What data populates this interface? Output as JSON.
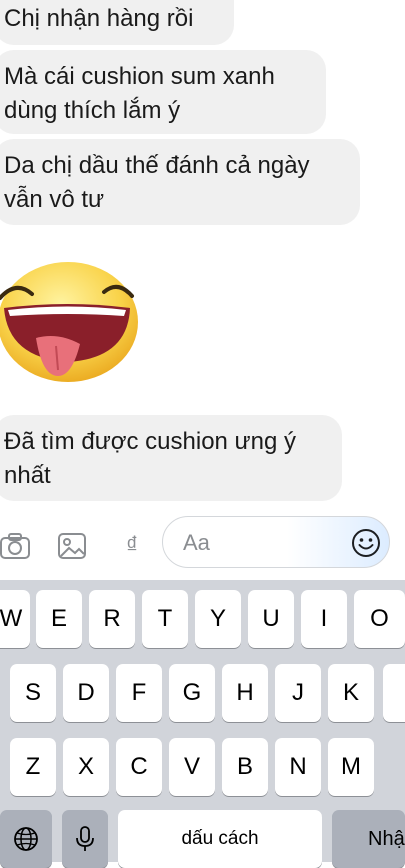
{
  "messages": [
    {
      "text": "Chị nhận hàng rồi"
    },
    {
      "text": "Mà cái cushion sum xanh\ndùng thích lắm ý"
    },
    {
      "text": "Da chị dầu thế đánh cả ngày\nvẫn vô tư"
    },
    {
      "text": "Đã tìm được cushion ưng ý\nnhất"
    }
  ],
  "sticker": {
    "icon": "laughing-tongue-emoji-sticker"
  },
  "composer": {
    "tools": [
      "camera-icon",
      "photo-icon",
      "dong-currency-icon"
    ],
    "dong_symbol": "₫",
    "placeholder": "Aa",
    "emoji_button": "smiley-icon"
  },
  "keyboard": {
    "row1": [
      "W",
      "E",
      "R",
      "T",
      "Y",
      "U",
      "I",
      "O"
    ],
    "row2": [
      "S",
      "D",
      "F",
      "G",
      "H",
      "J",
      "K"
    ],
    "row3": [
      "Z",
      "X",
      "C",
      "V",
      "B",
      "N",
      "M"
    ],
    "space_label": "dấu cách",
    "return_label": "Nhập",
    "globe_icon": "globe-icon",
    "mic_icon": "microphone-icon"
  },
  "colors": {
    "bubble": "#f0f0f0",
    "keyboard_bg": "#d1d4da",
    "key": "#ffffff",
    "key_dark": "#abb0ba"
  }
}
